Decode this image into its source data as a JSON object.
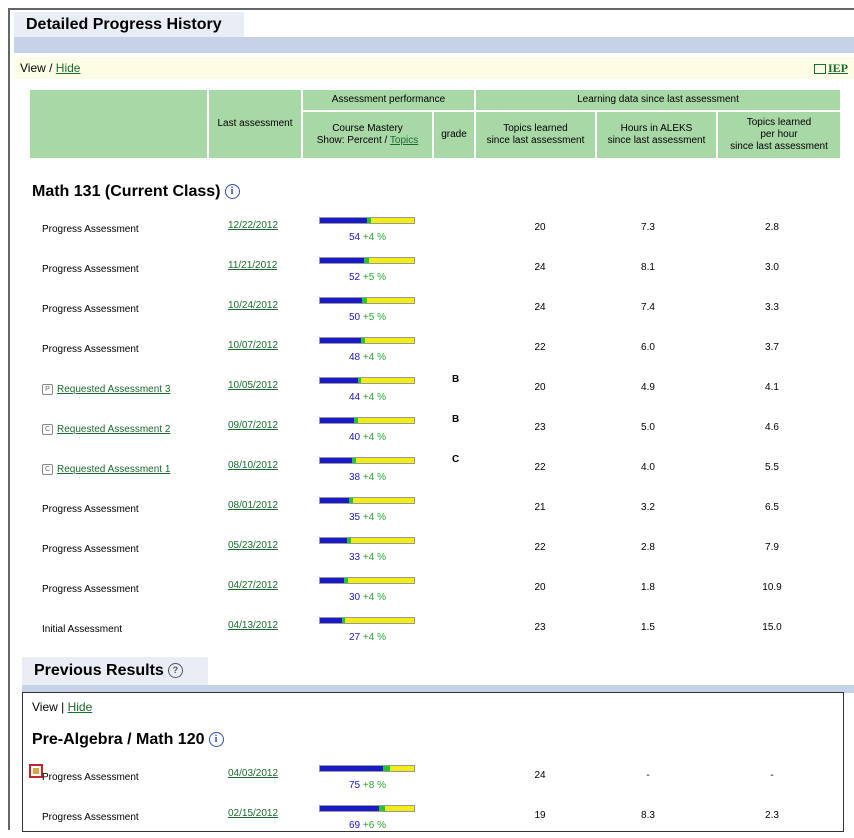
{
  "title": "Detailed Progress History",
  "view": {
    "view_label": "View / ",
    "hide_label": "Hide",
    "iep_label": "IEP"
  },
  "header": {
    "last_assessment": "Last assessment",
    "assessment_performance": "Assessment performance",
    "learning_data": "Learning data since last assessment",
    "course_mastery": "Course Mastery",
    "show_prefix": "Show: Percent / ",
    "topics_link": "Topics",
    "grade": "grade",
    "topics_learned_1": "Topics learned",
    "topics_learned_2": "since last assessment",
    "hours_1": "Hours in ALEKS",
    "hours_2": "since last assessment",
    "tph_1": "Topics learned",
    "tph_2": "per hour",
    "tph_3": "since last assessment"
  },
  "current_class": {
    "title": "Math 131 (Current Class)",
    "rows": [
      {
        "name": "Progress Assessment",
        "link": false,
        "badge": "",
        "date": "12/22/2012",
        "mastery": 54,
        "gain": 4,
        "pct_text": "54",
        "gain_text": "+4 %",
        "grade": "",
        "topics": "20",
        "hours": "7.3",
        "tph": "2.8"
      },
      {
        "name": "Progress Assessment",
        "link": false,
        "badge": "",
        "date": "11/21/2012",
        "mastery": 52,
        "gain": 5,
        "pct_text": "52",
        "gain_text": "+5 %",
        "grade": "",
        "topics": "24",
        "hours": "8.1",
        "tph": "3.0"
      },
      {
        "name": "Progress Assessment",
        "link": false,
        "badge": "",
        "date": "10/24/2012",
        "mastery": 50,
        "gain": 5,
        "pct_text": "50",
        "gain_text": "+5 %",
        "grade": "",
        "topics": "24",
        "hours": "7.4",
        "tph": "3.3"
      },
      {
        "name": "Progress Assessment",
        "link": false,
        "badge": "",
        "date": "10/07/2012",
        "mastery": 48,
        "gain": 4,
        "pct_text": "48",
        "gain_text": "+4 %",
        "grade": "",
        "topics": "22",
        "hours": "6.0",
        "tph": "3.7"
      },
      {
        "name": "Requested Assessment 3",
        "link": true,
        "badge": "P",
        "date": "10/05/2012",
        "mastery": 44,
        "gain": 4,
        "pct_text": "44",
        "gain_text": "+4 %",
        "grade": "B",
        "topics": "20",
        "hours": "4.9",
        "tph": "4.1"
      },
      {
        "name": "Requested Assessment 2",
        "link": true,
        "badge": "C",
        "date": "09/07/2012",
        "mastery": 40,
        "gain": 4,
        "pct_text": "40",
        "gain_text": "+4 %",
        "grade": "B",
        "topics": "23",
        "hours": "5.0",
        "tph": "4.6"
      },
      {
        "name": "Requested Assessment 1",
        "link": true,
        "badge": "C",
        "date": "08/10/2012",
        "mastery": 38,
        "gain": 4,
        "pct_text": "38",
        "gain_text": "+4 %",
        "grade": "C",
        "topics": "22",
        "hours": "4.0",
        "tph": "5.5"
      },
      {
        "name": "Progress Assessment",
        "link": false,
        "badge": "",
        "date": "08/01/2012",
        "mastery": 35,
        "gain": 4,
        "pct_text": "35",
        "gain_text": "+4 %",
        "grade": "",
        "topics": "21",
        "hours": "3.2",
        "tph": "6.5"
      },
      {
        "name": "Progress Assessment",
        "link": false,
        "badge": "",
        "date": "05/23/2012",
        "mastery": 33,
        "gain": 4,
        "pct_text": "33",
        "gain_text": "+4 %",
        "grade": "",
        "topics": "22",
        "hours": "2.8",
        "tph": "7.9"
      },
      {
        "name": "Progress Assessment",
        "link": false,
        "badge": "",
        "date": "04/27/2012",
        "mastery": 30,
        "gain": 4,
        "pct_text": "30",
        "gain_text": "+4 %",
        "grade": "",
        "topics": "20",
        "hours": "1.8",
        "tph": "10.9"
      },
      {
        "name": "Initial Assessment",
        "link": false,
        "badge": "",
        "date": "04/13/2012",
        "mastery": 27,
        "gain": 4,
        "pct_text": "27",
        "gain_text": "+4 %",
        "grade": "",
        "topics": "23",
        "hours": "1.5",
        "tph": "15.0"
      }
    ]
  },
  "previous": {
    "title": "Previous Results",
    "view_label": "View | ",
    "hide_label": "Hide",
    "class_title": "Pre-Algebra / Math 120",
    "rows": [
      {
        "name": "Progress Assessment",
        "link": false,
        "badge": "",
        "date": "04/03/2012",
        "mastery": 75,
        "gain": 8,
        "pct_text": "75",
        "gain_text": "+8 %",
        "grade": "",
        "topics": "24",
        "hours": "-",
        "tph": "-"
      },
      {
        "name": "Progress Assessment",
        "link": false,
        "badge": "",
        "date": "02/15/2012",
        "mastery": 69,
        "gain": 6,
        "pct_text": "69",
        "gain_text": "+6 %",
        "grade": "",
        "topics": "19",
        "hours": "8.3",
        "tph": "2.3"
      }
    ]
  },
  "colors": {
    "header_green": "#a9d8a7",
    "mastery_blue": "#1a19c8",
    "gain_green": "#27c42c",
    "remaining_yellow": "#f2ec17",
    "link_green": "#1b6b2f"
  }
}
